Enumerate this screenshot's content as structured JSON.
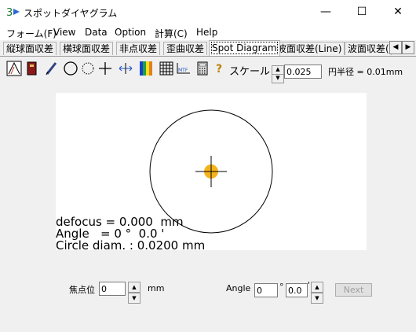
{
  "window": {
    "title": "スポットダイヤグラム",
    "minimize": "—",
    "maximize": "☐",
    "close": "✕"
  },
  "menu": [
    "フォーム(F)",
    "View",
    "Data",
    "Option",
    "計算(C)",
    "Help"
  ],
  "tabs": [
    "縦球面収差",
    "横球面収差",
    "非点収差",
    "歪曲収差",
    "Spot Diagram",
    "波面収差(Line)",
    "波面収差("
  ],
  "active_tab": "Spot Diagram",
  "toolbar": {
    "scale_label": "スケール",
    "scale_value": "0.025",
    "circle_radius_text": "円半径 = 0.01mm"
  },
  "diagram": {
    "defocus_text": "defocus = 0.000  mm",
    "angle_text": "Angle   = 0 °  0.0 '",
    "circle_text": "Circle diam. : 0.0200 mm",
    "spot_color": "#f4b31c"
  },
  "bottom": {
    "focus_label": "焦点位",
    "focus_value": "0",
    "focus_unit": "mm",
    "angle_label": "Angle =",
    "angle_deg": "0",
    "deg_symbol": "°",
    "angle_min": "0.0",
    "min_symbol": "'",
    "next_label": "Next"
  }
}
